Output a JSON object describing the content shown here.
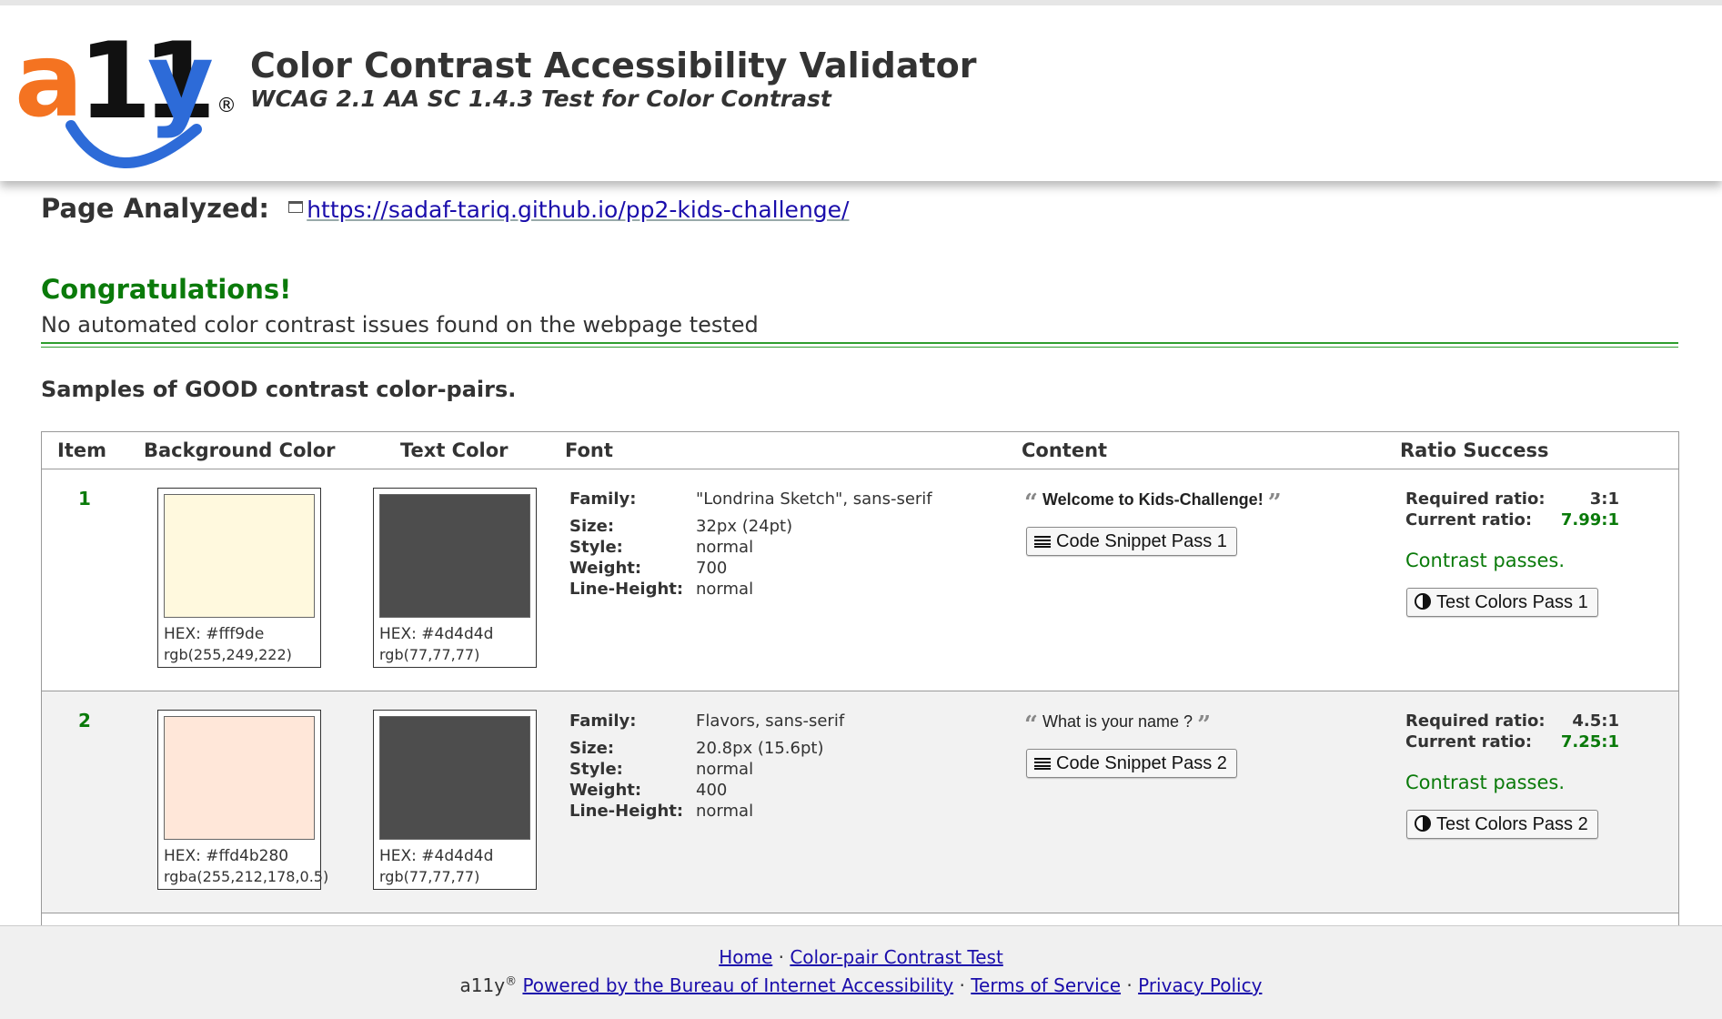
{
  "header": {
    "logo_a": "a",
    "logo_11": "11",
    "logo_y": "y",
    "logo_reg": "®",
    "title": "Color Contrast Accessibility Validator",
    "subtitle": "WCAG 2.1 AA SC 1.4.3 Test for Color Contrast"
  },
  "analyzed": {
    "label": "Page Analyzed:",
    "url": "https://sadaf-tariq.github.io/pp2-kids-challenge/"
  },
  "result": {
    "heading": "Congratulations!",
    "message": "No automated color contrast issues found on the webpage tested"
  },
  "samples_heading": "Samples of GOOD contrast color-pairs.",
  "table": {
    "headers": [
      "Item",
      "Background Color",
      "Text Color",
      "Font",
      "Content",
      "Ratio Success"
    ],
    "font_labels": [
      "Family:",
      "Size:",
      "Style:",
      "Weight:",
      "Line-Height:"
    ],
    "ratio_labels": [
      "Required ratio:",
      "Current ratio:"
    ],
    "rows": [
      {
        "item": "1",
        "bg_color": "#fff9de",
        "bg_hex": "HEX: #fff9de",
        "bg_rgb": "rgb(255,249,222)",
        "text_color": "#4d4d4d",
        "text_hex": "HEX: #4d4d4d",
        "text_rgb": "rgb(77,77,77)",
        "family": "\"Londrina Sketch\", sans-serif",
        "size": "32px (24pt)",
        "style": "normal",
        "weight": "700",
        "line_height": "normal",
        "content": "Welcome to Kids-Challenge!",
        "snippet_label": "Code Snippet Pass 1",
        "required_ratio": "3:1",
        "current_ratio": "7.99:1",
        "status": "Contrast passes.",
        "test_label": "Test Colors Pass 1"
      },
      {
        "item": "2",
        "bg_color": "#ffe7d9",
        "bg_hex": "HEX: #ffd4b280",
        "bg_rgb": "rgba(255,212,178,0.5)",
        "text_color": "#4d4d4d",
        "text_hex": "HEX: #4d4d4d",
        "text_rgb": "rgb(77,77,77)",
        "family": "Flavors, sans-serif",
        "size": "20.8px (15.6pt)",
        "style": "normal",
        "weight": "400",
        "line_height": "normal",
        "content": "What is your name ?",
        "snippet_label": "Code Snippet Pass 2",
        "required_ratio": "4.5:1",
        "current_ratio": "7.25:1",
        "status": "Contrast passes.",
        "test_label": "Test Colors Pass 2"
      }
    ]
  },
  "footer": {
    "home": "Home",
    "separator": "·",
    "colorpair": "Color-pair Contrast Test",
    "brand": "a11y",
    "brand_reg": "®",
    "powered": "Powered by the Bureau of Internet Accessibility",
    "terms": "Terms of Service",
    "privacy": "Privacy Policy"
  },
  "colors": {
    "accent_green": "#0a7a0a",
    "logo_orange": "#f47321",
    "logo_blue": "#2d6bd8",
    "link": "#1a0dab"
  }
}
